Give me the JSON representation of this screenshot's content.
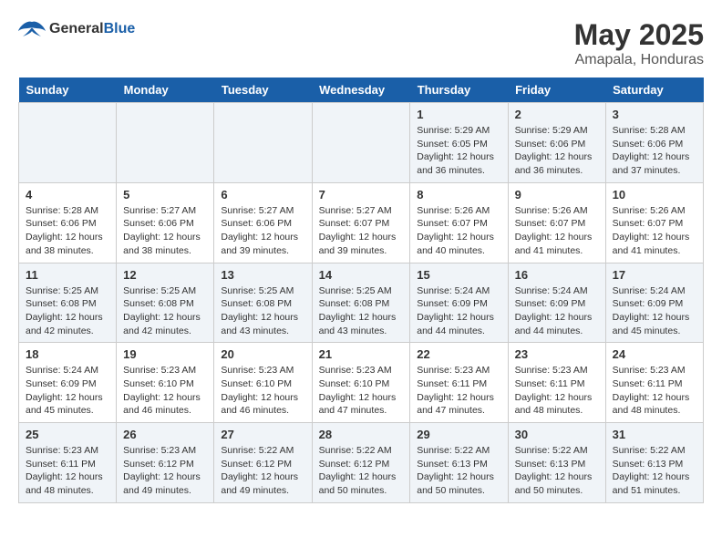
{
  "header": {
    "logo_general": "General",
    "logo_blue": "Blue",
    "month_year": "May 2025",
    "location": "Amapala, Honduras"
  },
  "days_of_week": [
    "Sunday",
    "Monday",
    "Tuesday",
    "Wednesday",
    "Thursday",
    "Friday",
    "Saturday"
  ],
  "weeks": [
    [
      {
        "day": "",
        "info": ""
      },
      {
        "day": "",
        "info": ""
      },
      {
        "day": "",
        "info": ""
      },
      {
        "day": "",
        "info": ""
      },
      {
        "day": "1",
        "info": "Sunrise: 5:29 AM\nSunset: 6:05 PM\nDaylight: 12 hours\nand 36 minutes."
      },
      {
        "day": "2",
        "info": "Sunrise: 5:29 AM\nSunset: 6:06 PM\nDaylight: 12 hours\nand 36 minutes."
      },
      {
        "day": "3",
        "info": "Sunrise: 5:28 AM\nSunset: 6:06 PM\nDaylight: 12 hours\nand 37 minutes."
      }
    ],
    [
      {
        "day": "4",
        "info": "Sunrise: 5:28 AM\nSunset: 6:06 PM\nDaylight: 12 hours\nand 38 minutes."
      },
      {
        "day": "5",
        "info": "Sunrise: 5:27 AM\nSunset: 6:06 PM\nDaylight: 12 hours\nand 38 minutes."
      },
      {
        "day": "6",
        "info": "Sunrise: 5:27 AM\nSunset: 6:06 PM\nDaylight: 12 hours\nand 39 minutes."
      },
      {
        "day": "7",
        "info": "Sunrise: 5:27 AM\nSunset: 6:07 PM\nDaylight: 12 hours\nand 39 minutes."
      },
      {
        "day": "8",
        "info": "Sunrise: 5:26 AM\nSunset: 6:07 PM\nDaylight: 12 hours\nand 40 minutes."
      },
      {
        "day": "9",
        "info": "Sunrise: 5:26 AM\nSunset: 6:07 PM\nDaylight: 12 hours\nand 41 minutes."
      },
      {
        "day": "10",
        "info": "Sunrise: 5:26 AM\nSunset: 6:07 PM\nDaylight: 12 hours\nand 41 minutes."
      }
    ],
    [
      {
        "day": "11",
        "info": "Sunrise: 5:25 AM\nSunset: 6:08 PM\nDaylight: 12 hours\nand 42 minutes."
      },
      {
        "day": "12",
        "info": "Sunrise: 5:25 AM\nSunset: 6:08 PM\nDaylight: 12 hours\nand 42 minutes."
      },
      {
        "day": "13",
        "info": "Sunrise: 5:25 AM\nSunset: 6:08 PM\nDaylight: 12 hours\nand 43 minutes."
      },
      {
        "day": "14",
        "info": "Sunrise: 5:25 AM\nSunset: 6:08 PM\nDaylight: 12 hours\nand 43 minutes."
      },
      {
        "day": "15",
        "info": "Sunrise: 5:24 AM\nSunset: 6:09 PM\nDaylight: 12 hours\nand 44 minutes."
      },
      {
        "day": "16",
        "info": "Sunrise: 5:24 AM\nSunset: 6:09 PM\nDaylight: 12 hours\nand 44 minutes."
      },
      {
        "day": "17",
        "info": "Sunrise: 5:24 AM\nSunset: 6:09 PM\nDaylight: 12 hours\nand 45 minutes."
      }
    ],
    [
      {
        "day": "18",
        "info": "Sunrise: 5:24 AM\nSunset: 6:09 PM\nDaylight: 12 hours\nand 45 minutes."
      },
      {
        "day": "19",
        "info": "Sunrise: 5:23 AM\nSunset: 6:10 PM\nDaylight: 12 hours\nand 46 minutes."
      },
      {
        "day": "20",
        "info": "Sunrise: 5:23 AM\nSunset: 6:10 PM\nDaylight: 12 hours\nand 46 minutes."
      },
      {
        "day": "21",
        "info": "Sunrise: 5:23 AM\nSunset: 6:10 PM\nDaylight: 12 hours\nand 47 minutes."
      },
      {
        "day": "22",
        "info": "Sunrise: 5:23 AM\nSunset: 6:11 PM\nDaylight: 12 hours\nand 47 minutes."
      },
      {
        "day": "23",
        "info": "Sunrise: 5:23 AM\nSunset: 6:11 PM\nDaylight: 12 hours\nand 48 minutes."
      },
      {
        "day": "24",
        "info": "Sunrise: 5:23 AM\nSunset: 6:11 PM\nDaylight: 12 hours\nand 48 minutes."
      }
    ],
    [
      {
        "day": "25",
        "info": "Sunrise: 5:23 AM\nSunset: 6:11 PM\nDaylight: 12 hours\nand 48 minutes."
      },
      {
        "day": "26",
        "info": "Sunrise: 5:23 AM\nSunset: 6:12 PM\nDaylight: 12 hours\nand 49 minutes."
      },
      {
        "day": "27",
        "info": "Sunrise: 5:22 AM\nSunset: 6:12 PM\nDaylight: 12 hours\nand 49 minutes."
      },
      {
        "day": "28",
        "info": "Sunrise: 5:22 AM\nSunset: 6:12 PM\nDaylight: 12 hours\nand 50 minutes."
      },
      {
        "day": "29",
        "info": "Sunrise: 5:22 AM\nSunset: 6:13 PM\nDaylight: 12 hours\nand 50 minutes."
      },
      {
        "day": "30",
        "info": "Sunrise: 5:22 AM\nSunset: 6:13 PM\nDaylight: 12 hours\nand 50 minutes."
      },
      {
        "day": "31",
        "info": "Sunrise: 5:22 AM\nSunset: 6:13 PM\nDaylight: 12 hours\nand 51 minutes."
      }
    ]
  ]
}
